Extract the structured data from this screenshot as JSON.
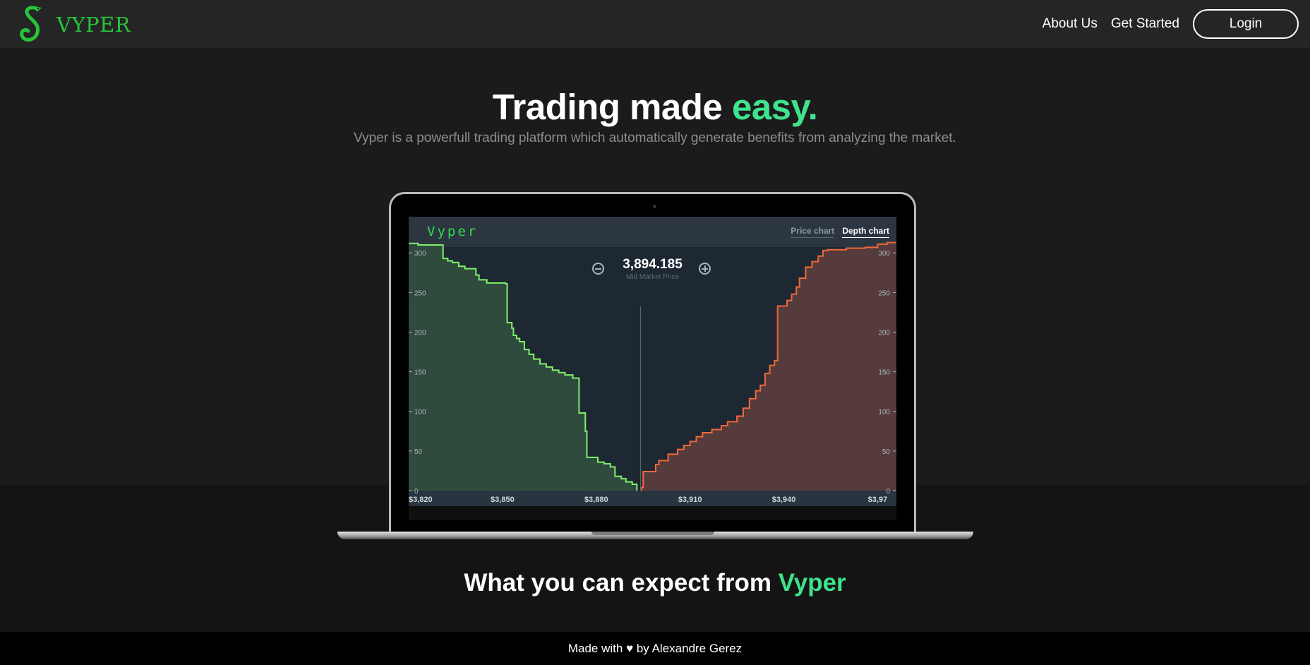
{
  "nav": {
    "brand": "VYPER",
    "links": [
      "About Us",
      "Get Started"
    ],
    "login": "Login"
  },
  "hero": {
    "title_main": "Trading made ",
    "title_accent": "easy.",
    "subtitle": "Vyper is a powerfull trading platform which automatically generate benefits from analyzing the market."
  },
  "app": {
    "logo": "Vyper",
    "tabs": [
      "Price chart",
      "Depth chart"
    ],
    "active_tab": "Depth chart",
    "mid_price": "3,894.185",
    "mid_label": "Mid Market Price"
  },
  "section2": {
    "title_main": "What you can expect from ",
    "title_accent": "Vyper"
  },
  "footer": {
    "before": "Made with ",
    "heart": "♥",
    "after": " by Alexandre Gerez"
  },
  "colors": {
    "accent": "#3ee38c",
    "brand": "#27c33a",
    "bid_line": "#7ff06a",
    "bid_fill": "#2f4b3d",
    "ask_line": "#f2683a",
    "ask_fill": "#553b3b"
  },
  "chart_data": {
    "type": "area",
    "title": "",
    "xlabel": "",
    "ylabel": "",
    "xlim": [
      3820,
      3976
    ],
    "ylim": [
      0,
      310
    ],
    "x_ticks": [
      3820,
      3850,
      3880,
      3910,
      3940,
      3970
    ],
    "x_tick_labels": [
      "$3,820",
      "$3,850",
      "$3,880",
      "$3,910",
      "$3,940",
      "$3,97"
    ],
    "y_ticks": [
      0,
      50,
      100,
      150,
      200,
      250,
      300
    ],
    "grid": false,
    "mid_price": 3894.185,
    "series": [
      {
        "side": "bid",
        "x": [
          3820,
          3823,
          3830.5,
          3831,
          3832.5,
          3834,
          3836,
          3838,
          3841.5,
          3842.5,
          3845,
          3851,
          3851.5,
          3853,
          3853.5,
          3854.5,
          3855.5,
          3857,
          3858.5,
          3860,
          3862,
          3864,
          3866,
          3868,
          3870,
          3872.5,
          3872.5,
          3874.5,
          3876.5,
          3877,
          3880.5,
          3882.5,
          3884.5,
          3886,
          3888,
          3889.5,
          3891.5,
          3893
        ],
        "y": [
          312,
          310,
          310,
          293,
          290,
          288,
          283,
          280,
          272,
          266,
          262,
          261,
          212,
          205,
          196,
          192,
          188,
          178,
          172,
          166,
          160,
          156,
          152,
          149,
          146,
          143,
          142,
          98,
          75,
          42,
          36,
          34,
          30,
          18,
          15,
          11,
          8,
          3
        ]
      },
      {
        "side": "ask",
        "x": [
          3894.5,
          3895,
          3899,
          3900,
          3903,
          3906,
          3908,
          3910,
          3912,
          3914,
          3917,
          3920,
          3922,
          3925,
          3927,
          3929,
          3931,
          3932.5,
          3934,
          3935.5,
          3937,
          3938,
          3941,
          3942.5,
          3944,
          3945,
          3947,
          3949,
          3951,
          3952.5,
          3954,
          3960,
          3966,
          3970,
          3973
        ],
        "y": [
          4,
          24,
          33,
          38,
          46,
          52,
          57,
          62,
          68,
          73,
          77,
          82,
          87,
          94,
          104,
          116,
          126,
          133,
          148,
          158,
          164,
          233,
          240,
          248,
          257,
          268,
          282,
          289,
          296,
          303,
          304,
          306,
          307,
          311,
          313
        ]
      }
    ]
  }
}
